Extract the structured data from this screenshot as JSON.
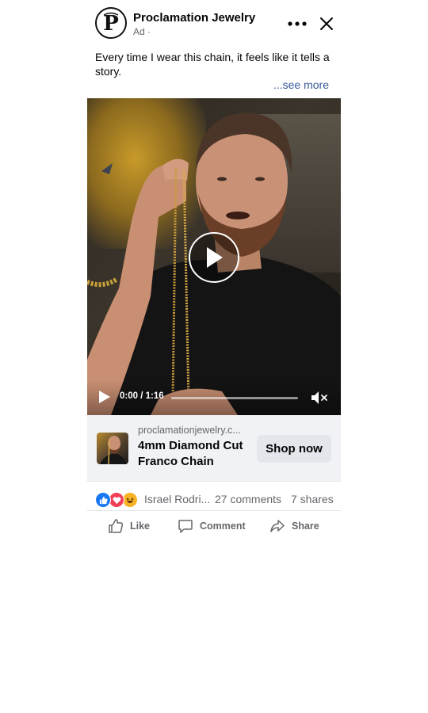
{
  "post": {
    "page_name": "Proclamation Jewelry",
    "meta": "Ad ·",
    "caption": "Every time I wear this chain, it feels like it tells a story.",
    "see_more": "...see more"
  },
  "video": {
    "time": "0:00 / 1:16",
    "progress": 0
  },
  "link_card": {
    "domain": "proclamationjewelry.c...",
    "product_title": "4mm Diamond Cut Franco Chain",
    "cta": "Shop now"
  },
  "reactions": {
    "icons": [
      "like-icon",
      "love-icon",
      "haha-icon"
    ],
    "reactors": "Israel Rodri...",
    "comments": "27 comments",
    "shares": "7 shares"
  },
  "actions": {
    "like": "Like",
    "comment": "Comment",
    "share": "Share"
  },
  "colors": {
    "link": "#385898",
    "like_blue": "#1877f2",
    "love_red": "#f33e58",
    "haha_yellow": "#f7b125",
    "muted": "#65676b",
    "card_bg": "#f0f2f5"
  }
}
